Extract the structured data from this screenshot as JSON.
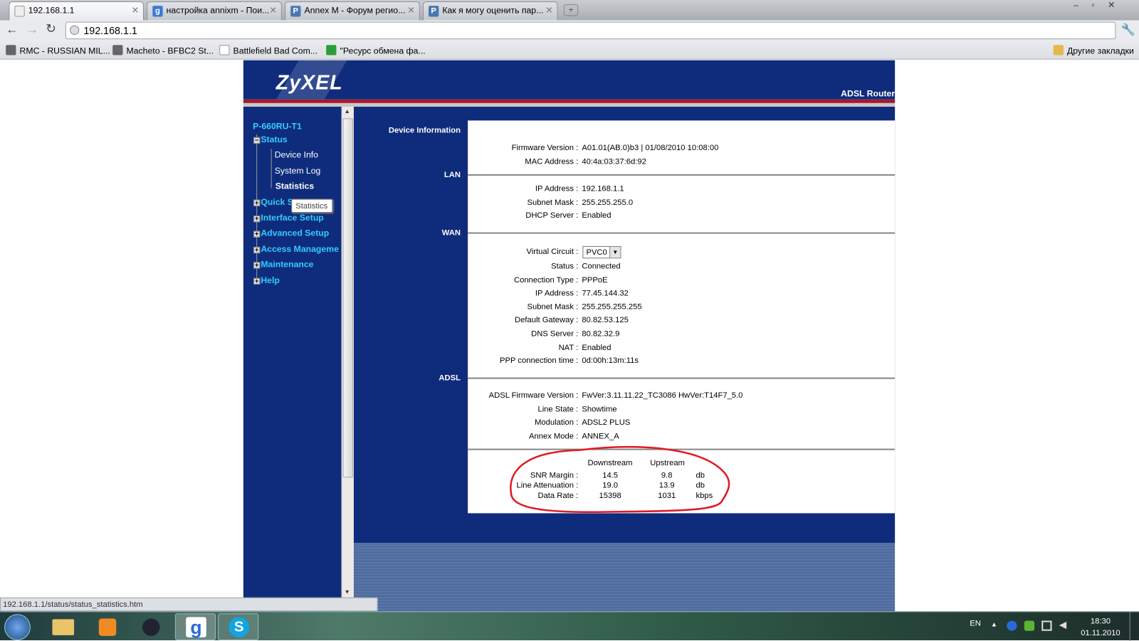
{
  "browser": {
    "tabs": [
      {
        "title": "192.168.1.1",
        "active": true,
        "icon": "page-icon"
      },
      {
        "title": "настройка annixm - Пои...",
        "icon": "google-icon"
      },
      {
        "title": "Annex M - Форум регио...",
        "icon": "p-icon"
      },
      {
        "title": "Как я могу оценить пар...",
        "icon": "p-icon"
      }
    ],
    "address": "192.168.1.1",
    "bookmarks": [
      "RMC - RUSSIAN MIL...",
      "Macheto - BFBC2 St...",
      "Battlefield Bad Com...",
      "\"Ресурс обмена фа..."
    ],
    "other_bookmarks": "Другие закладки",
    "status_url": "192.168.1.1/status/status_statistics.htm"
  },
  "router": {
    "brand": "ZyXEL",
    "product": "ADSL Router",
    "model": "P-660RU-T1",
    "nav": [
      {
        "label": "Status",
        "expanded": true,
        "children": [
          "Device Info",
          "System Log",
          "Statistics"
        ]
      },
      {
        "label": "Quick S"
      },
      {
        "label": "Interface Setup"
      },
      {
        "label": "Advanced Setup"
      },
      {
        "label": "Access Manageme"
      },
      {
        "label": "Maintenance"
      },
      {
        "label": "Help"
      }
    ],
    "tooltip": "Statistics",
    "sections": {
      "device": "Device Information",
      "lan": "LAN",
      "wan": "WAN",
      "adsl": "ADSL"
    },
    "device": [
      [
        "Firmware Version :",
        "A01.01(AB.0)b3 | 01/08/2010 10:08:00"
      ],
      [
        "MAC Address :",
        "40:4a:03:37:6d:92"
      ]
    ],
    "lan": [
      [
        "IP Address :",
        "192.168.1.1"
      ],
      [
        "Subnet Mask :",
        "255.255.255.0"
      ],
      [
        "DHCP Server :",
        "Enabled"
      ]
    ],
    "wan_vc_label": "Virtual Circuit :",
    "wan_vc_value": "PVC0",
    "wan": [
      [
        "Status :",
        "Connected"
      ],
      [
        "Connection Type :",
        "PPPoE"
      ],
      [
        "IP Address :",
        "77.45.144.32"
      ],
      [
        "Subnet Mask :",
        "255.255.255.255"
      ],
      [
        "Default Gateway :",
        "80.82.53.125"
      ],
      [
        "DNS Server :",
        "80.82.32.9"
      ],
      [
        "NAT :",
        "Enabled"
      ],
      [
        "PPP connection time :",
        "0d:00h:13m:11s"
      ]
    ],
    "adsl": [
      [
        "ADSL Firmware Version :",
        "FwVer:3.11.11.22_TC3086 HwVer:T14F7_5.0"
      ],
      [
        "Line State :",
        "Showtime"
      ],
      [
        "Modulation :",
        "ADSL2 PLUS"
      ],
      [
        "Annex Mode :",
        "ANNEX_A"
      ]
    ],
    "stats": {
      "headers": [
        "Downstream",
        "Upstream"
      ],
      "rows": [
        [
          "SNR Margin :",
          "14.5",
          "9.8",
          "db"
        ],
        [
          "Line Attenuation :",
          "19.0",
          "13.9",
          "db"
        ],
        [
          "Data Rate :",
          "15398",
          "1031",
          "kbps"
        ]
      ]
    },
    "highlight_color": "#e01b24"
  },
  "taskbar": {
    "lang": "EN",
    "time": "18:30",
    "date": "01.11.2010"
  }
}
